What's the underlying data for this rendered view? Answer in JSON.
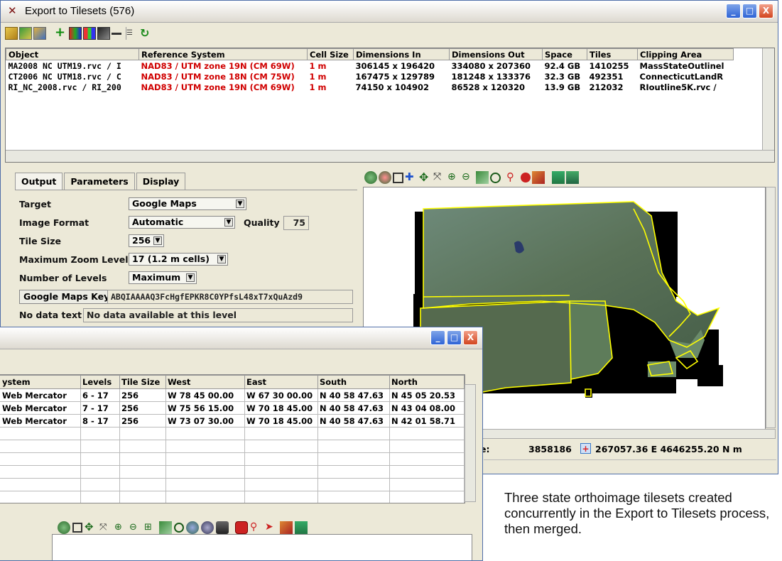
{
  "main_window": {
    "title": "Export to Tilesets (576)",
    "controls": [
      "_",
      "□",
      "X"
    ]
  },
  "toolbar_icons": [
    "open-icon",
    "sample-icon",
    "wizard-icon",
    "add-icon",
    "layer-icon",
    "layer-grid-icon",
    "layer-small-icon",
    "remove-icon",
    "list-icon",
    "refresh-icon"
  ],
  "object_table": {
    "columns": [
      "Object",
      "Reference System",
      "Cell Size",
      "Dimensions In",
      "Dimensions Out",
      "Space",
      "Tiles",
      "Clipping Area"
    ],
    "rows": [
      [
        "MA2008 NC UTM19.rvc / I",
        "NAD83 / UTM zone 19N (CM 69W)",
        "1 m",
        "306145 x 196420",
        "334080 x 207360",
        "92.4 GB",
        "1410255",
        "MassStateOutlinel"
      ],
      [
        "CT2006 NC UTM18.rvc / C",
        "NAD83 / UTM zone 18N (CM 75W)",
        "1 m",
        "167475 x 129789",
        "181248 x 133376",
        "32.3 GB",
        "492351",
        "ConnecticutLandR"
      ],
      [
        "RI_NC_2008.rvc / RI_200",
        "NAD83 / UTM zone 19N (CM 69W)",
        "1 m",
        "74150 x 104902",
        "86528 x 120320",
        "13.9 GB",
        "212032",
        "RIoutline5K.rvc /"
      ]
    ]
  },
  "tabs": [
    "Output",
    "Parameters",
    "Display"
  ],
  "form": {
    "target_label": "Target",
    "target_value": "Google Maps",
    "image_format_label": "Image Format",
    "image_format_value": "Automatic",
    "quality_label": "Quality",
    "quality_value": "75",
    "tile_size_label": "Tile Size",
    "tile_size_value": "256",
    "max_zoom_label": "Maximum Zoom Level",
    "max_zoom_value": "17 (1.2 m cells)",
    "num_levels_label": "Number of Levels",
    "num_levels_value": "Maximum",
    "maps_key_button": "Google Maps Key",
    "maps_key_value": "ABQIAAAAQ3FcHgfEPKR8C0YPfsL48xT7xQuAzd9",
    "nodata_label": "No data text",
    "nodata_value": "No data available at this level"
  },
  "map_toolbar_icons": [
    "refresh-icon",
    "redraw-icon",
    "fullview-icon",
    "zoom-box-icon",
    "pan-icon",
    "recenter-icon",
    "zoom-in-icon",
    "zoom-out-icon",
    "zoom-extent-icon",
    "target-icon",
    "search-icon",
    "stop-icon",
    "draw-icon",
    "table-icon",
    "layers-icon"
  ],
  "coord_bar": {
    "label_fragment": "e:",
    "cell_value": "3858186",
    "coordinates": "267057.36 E  4646255.20 N m"
  },
  "second_window": {
    "controls": [
      "_",
      "□",
      "X"
    ],
    "table": {
      "columns": [
        "ystem",
        "Levels",
        "Tile Size",
        "West",
        "East",
        "South",
        "North"
      ],
      "rows": [
        [
          "Web Mercator",
          "6 - 17",
          "256",
          "W 78 45 00.00",
          "W 67 30 00.00",
          "N 40 58 47.63",
          "N 45 05 20.53"
        ],
        [
          "Web Mercator",
          "7 - 17",
          "256",
          "W 75 56 15.00",
          "W 70 18 45.00",
          "N 40 58 47.63",
          "N 43 04 08.00"
        ],
        [
          "Web Mercator",
          "8 - 17",
          "256",
          "W 73 07 30.00",
          "W 70 18 45.00",
          "N 40 58 47.63",
          "N 42 01 58.71"
        ]
      ],
      "empty_rows": 6
    },
    "view_toolbar_icons": [
      "refresh-icon",
      "fullview-icon",
      "pan-icon",
      "recenter-icon",
      "zoom-in-icon",
      "zoom-out-icon",
      "zoom-box-icon",
      "zoom-extent-icon",
      "target-icon",
      "globe-icon",
      "sphere-icon",
      "camera-icon",
      "stop-icon",
      "search-icon",
      "pointer-icon",
      "draw-icon",
      "table-icon"
    ]
  },
  "caption": "Three state orthoimage tilesets created concurrently in the Export to Tilesets process, then merged.",
  "colors": {
    "reference_system_text": "#d00000",
    "boundary": "#ffff00",
    "imagery_green": "#5c7a5a"
  }
}
